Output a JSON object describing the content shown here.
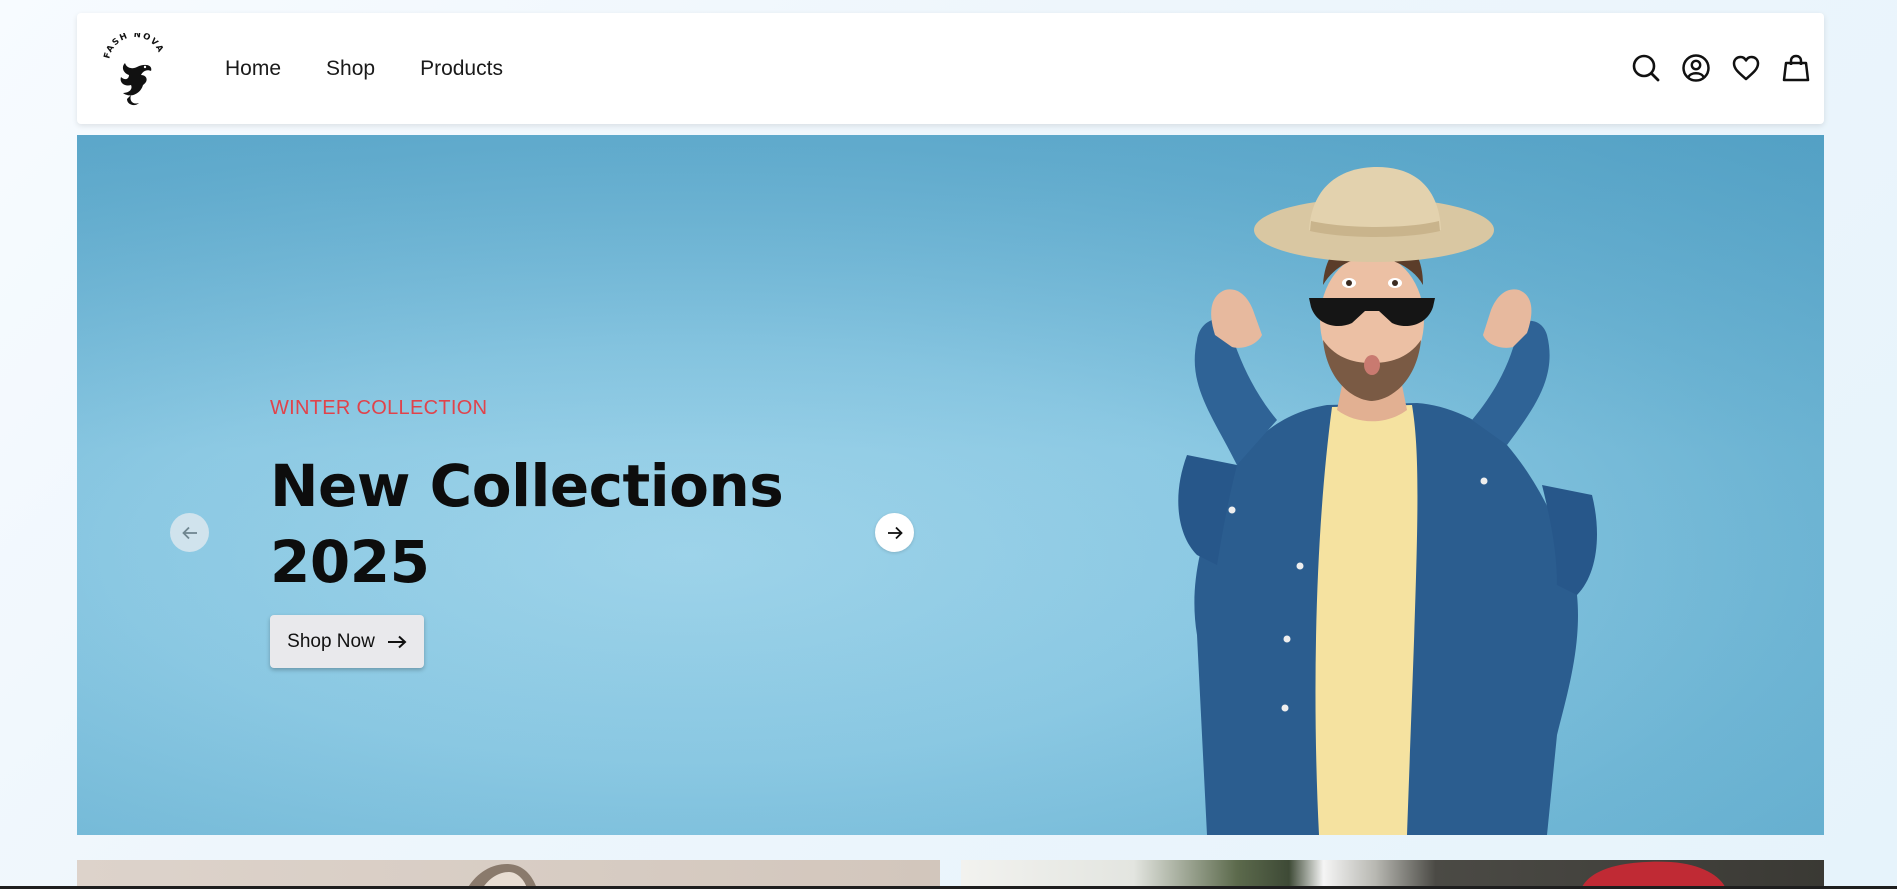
{
  "brand": {
    "name": "FASH NOVA"
  },
  "nav": {
    "items": [
      {
        "label": "Home"
      },
      {
        "label": "Shop"
      },
      {
        "label": "Products"
      }
    ]
  },
  "header_icons": [
    "search-icon",
    "account-icon",
    "wishlist-heart-icon",
    "shopping-bag-icon"
  ],
  "hero": {
    "eyebrow": "WINTER COLLECTION",
    "title": "New Collections 2025",
    "cta_label": "Shop Now",
    "cta_icon": "arrow-right-icon",
    "prev_icon": "arrow-left-icon",
    "next_icon": "arrow-right-icon"
  },
  "colors": {
    "accent": "#e0434b",
    "hero_bg": "#8cc9e3",
    "button_bg": "#e9e9ec",
    "text_dark": "#0d0d0d"
  }
}
